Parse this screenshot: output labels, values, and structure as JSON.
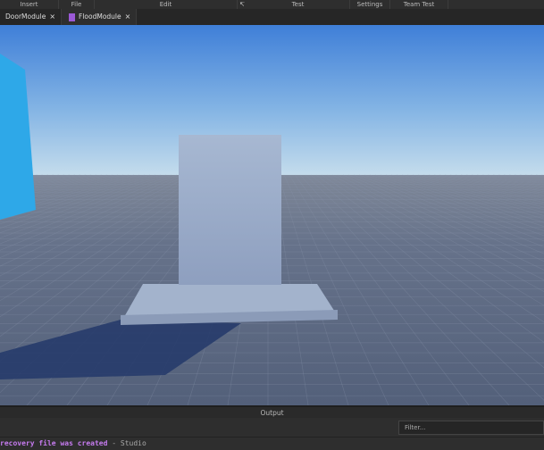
{
  "menubar": {
    "items": [
      "Insert",
      "File",
      "Edit",
      "↸",
      "Test",
      "Settings",
      "Team Test"
    ]
  },
  "tabs": [
    {
      "label": "DoorModule",
      "close": "×"
    },
    {
      "label": "FloodModule",
      "close": "×"
    }
  ],
  "output": {
    "title": "Output",
    "filter_placeholder": "Filter...",
    "log": [
      {
        "message": "recovery file was created",
        "separator": " - ",
        "source": "Studio"
      }
    ]
  },
  "colors": {
    "sky_top": "#3f7fd8",
    "sky_horizon": "#bcd8ec",
    "floor": "#5d6a80",
    "module_icon": "#9b59d6"
  }
}
